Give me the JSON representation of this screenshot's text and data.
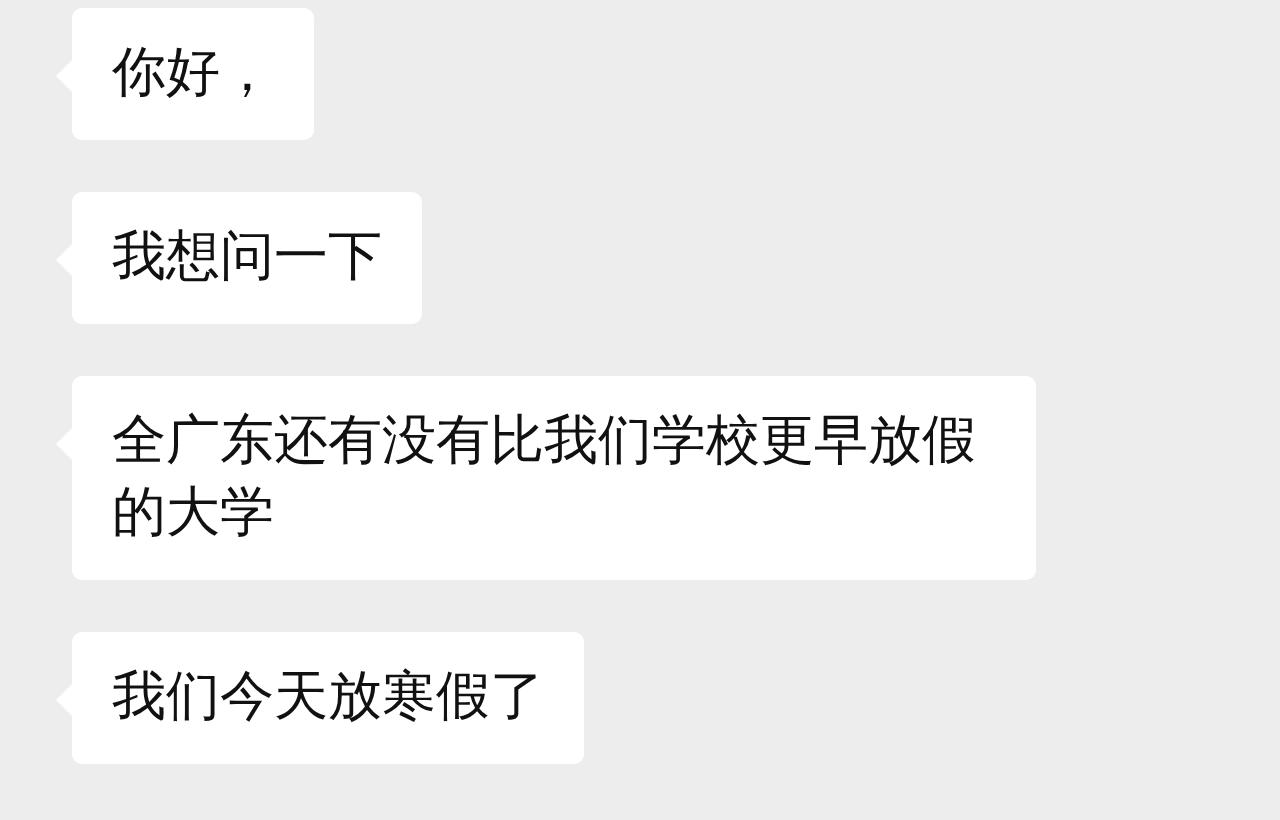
{
  "messages": [
    {
      "text": "你好，"
    },
    {
      "text": "我想问一下"
    },
    {
      "text": "全广东还有没有比我们学校更早放假的大学"
    },
    {
      "text": "我们今天放寒假了"
    }
  ]
}
